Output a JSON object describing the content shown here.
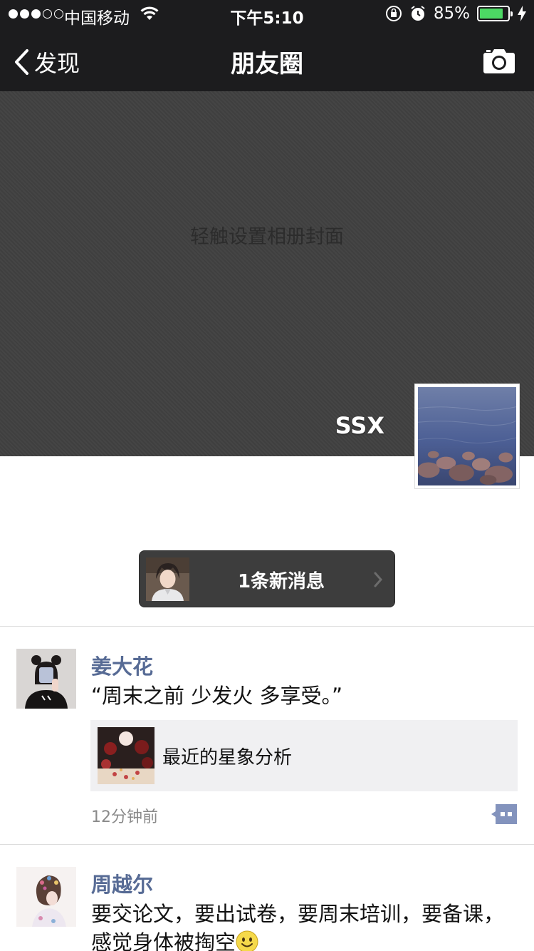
{
  "status_bar": {
    "carrier": "中国移动",
    "time": "下午5:10",
    "battery_percent": "85%",
    "battery_level": 0.85,
    "signal_bars_filled": 3,
    "signal_bars_total": 5
  },
  "nav": {
    "back_label": "发现",
    "title": "朋友圈"
  },
  "cover": {
    "hint": "轻触设置相册封面",
    "username": "SSX"
  },
  "new_message": {
    "text": "1条新消息"
  },
  "posts": [
    {
      "author": "姜大花",
      "text": "“周末之前 少发火 多享受。”",
      "share_title": "最近的星象分析",
      "time": "12分钟前"
    },
    {
      "author": "周越尔",
      "text": "要交论文，要出试卷，要周末培训，要备课，感觉身体被掏空"
    }
  ],
  "colors": {
    "nav_bg": "#1c1c1e",
    "author_name": "#576b95",
    "battery_fill": "#4cd964"
  }
}
